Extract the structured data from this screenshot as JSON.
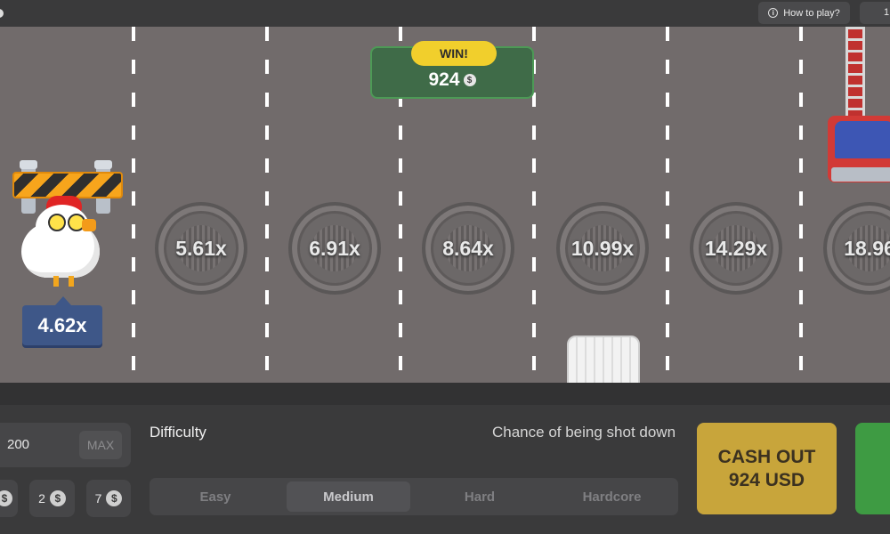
{
  "header": {
    "help_label": "How to play?",
    "partial_btn": "1"
  },
  "road": {
    "win_label": "WIN!",
    "win_amount": "924",
    "chicken_multiplier": "4.62x",
    "multipliers": [
      "5.61x",
      "6.91x",
      "8.64x",
      "10.99x",
      "14.29x",
      "18.96"
    ]
  },
  "controls": {
    "bet_value": "200",
    "max_label": "MAX",
    "chips": [
      "2",
      "7"
    ],
    "difficulty_label": "Difficulty",
    "chance_label": "Chance of being shot down",
    "difficulties": [
      "Easy",
      "Medium",
      "Hard",
      "Hardcore"
    ],
    "selected_difficulty": "Medium",
    "cashout_line1": "CASH OUT",
    "cashout_line2": "924 USD"
  },
  "icons": {
    "coin": "$",
    "info": "i"
  },
  "colors": {
    "road": "#716b6b",
    "cashout": "#c8a53b",
    "go": "#3e9b43",
    "win_badge": "#f1cf2c",
    "win_box": "#3f6b48",
    "chicken_multiplier_bg": "#3e5788"
  }
}
